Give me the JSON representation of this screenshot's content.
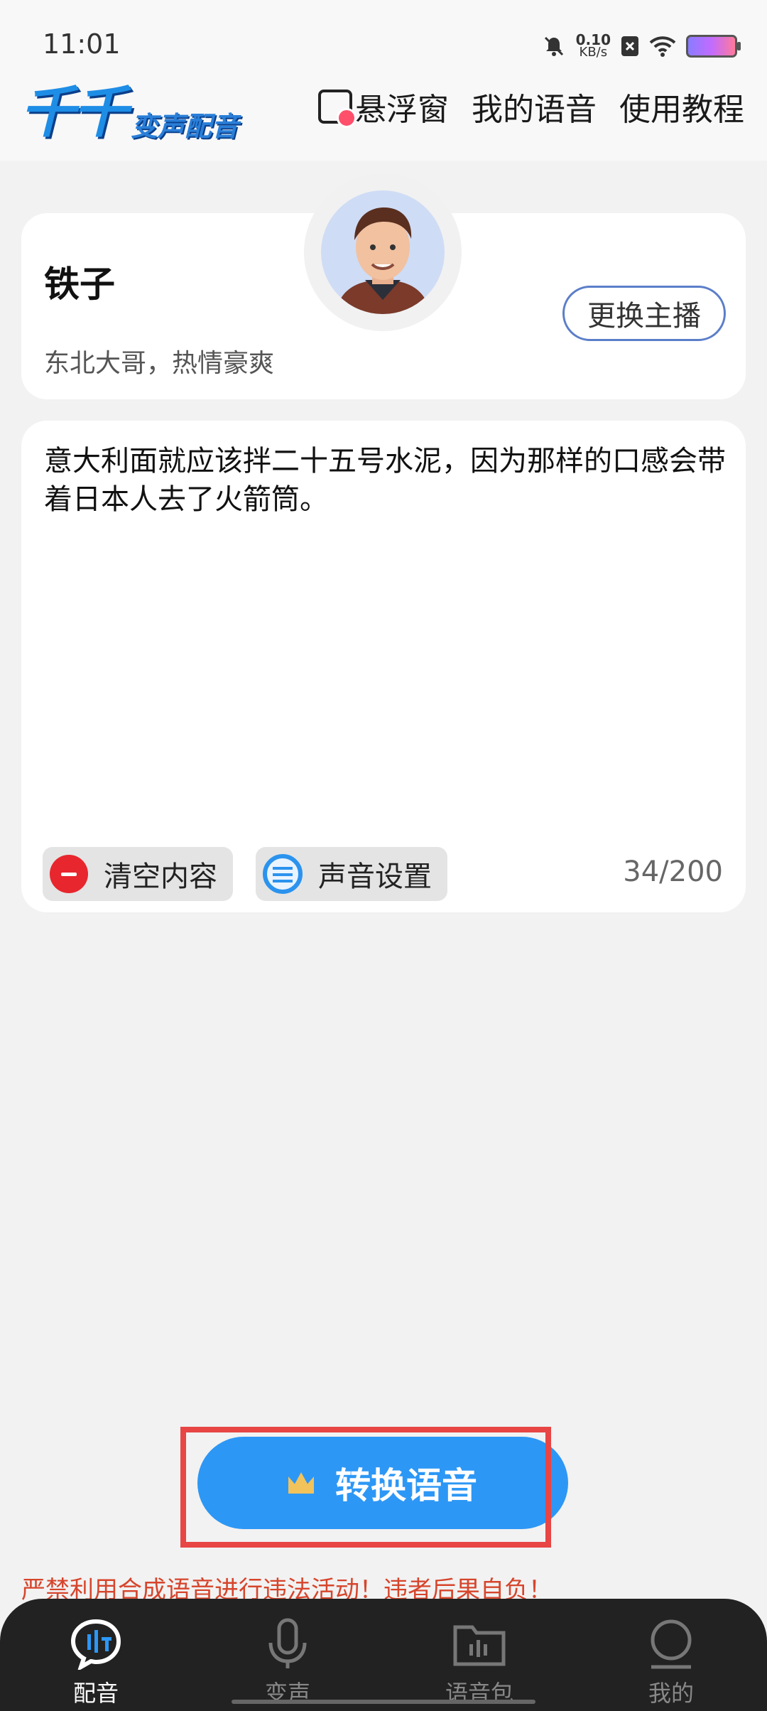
{
  "status_bar": {
    "time": "11:01",
    "net_speed_value": "0.10",
    "net_speed_unit": "KB/s"
  },
  "header": {
    "logo_main": "千千",
    "logo_sub": "变声配音",
    "links": [
      "悬浮窗",
      "我的语音",
      "使用教程"
    ]
  },
  "host": {
    "name": "铁子",
    "description": "东北大哥，热情豪爽",
    "change_label": "更换主播"
  },
  "editor": {
    "text": "意大利面就应该拌二十五号水泥，因为那样的口感会带着日本人去了火箭筒。",
    "clear_label": "清空内容",
    "settings_label": "声音设置",
    "counter": "34/200"
  },
  "convert_label": "转换语音",
  "warning": "严禁利用合成语音进行违法活动！违者后果自负！",
  "nav": {
    "items": [
      "配音",
      "变声",
      "语音包",
      "我的"
    ],
    "active": 0
  },
  "colors": {
    "accent": "#2d97f5",
    "warning": "#d6452c",
    "highlight": "#e84545",
    "nav_bg": "#222222"
  }
}
